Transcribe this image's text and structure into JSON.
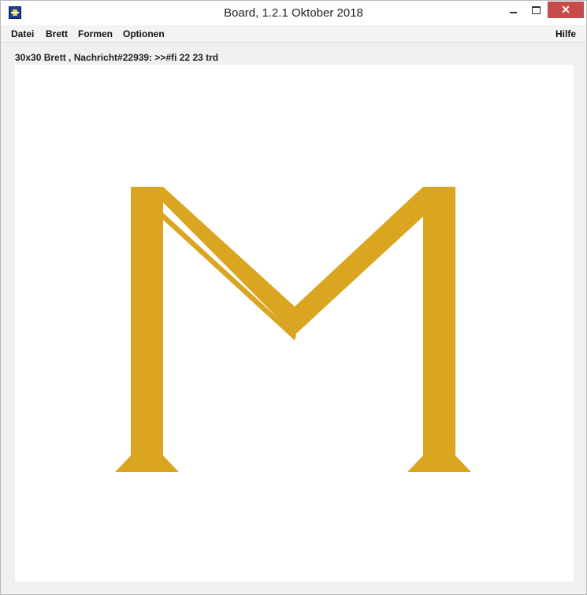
{
  "window": {
    "title": "Board, 1.2.1 Oktober 2018",
    "close_glyph": "✕"
  },
  "menu": {
    "datei": "Datei",
    "brett": "Brett",
    "formen": "Formen",
    "optionen": "Optionen",
    "hilfe": "Hilfe"
  },
  "status": {
    "text": "30x30 Brett , Nachricht#22939: >>#fi 22 23 trd"
  },
  "board": {
    "shape_color": "#daa520",
    "shape": "letter-m"
  }
}
